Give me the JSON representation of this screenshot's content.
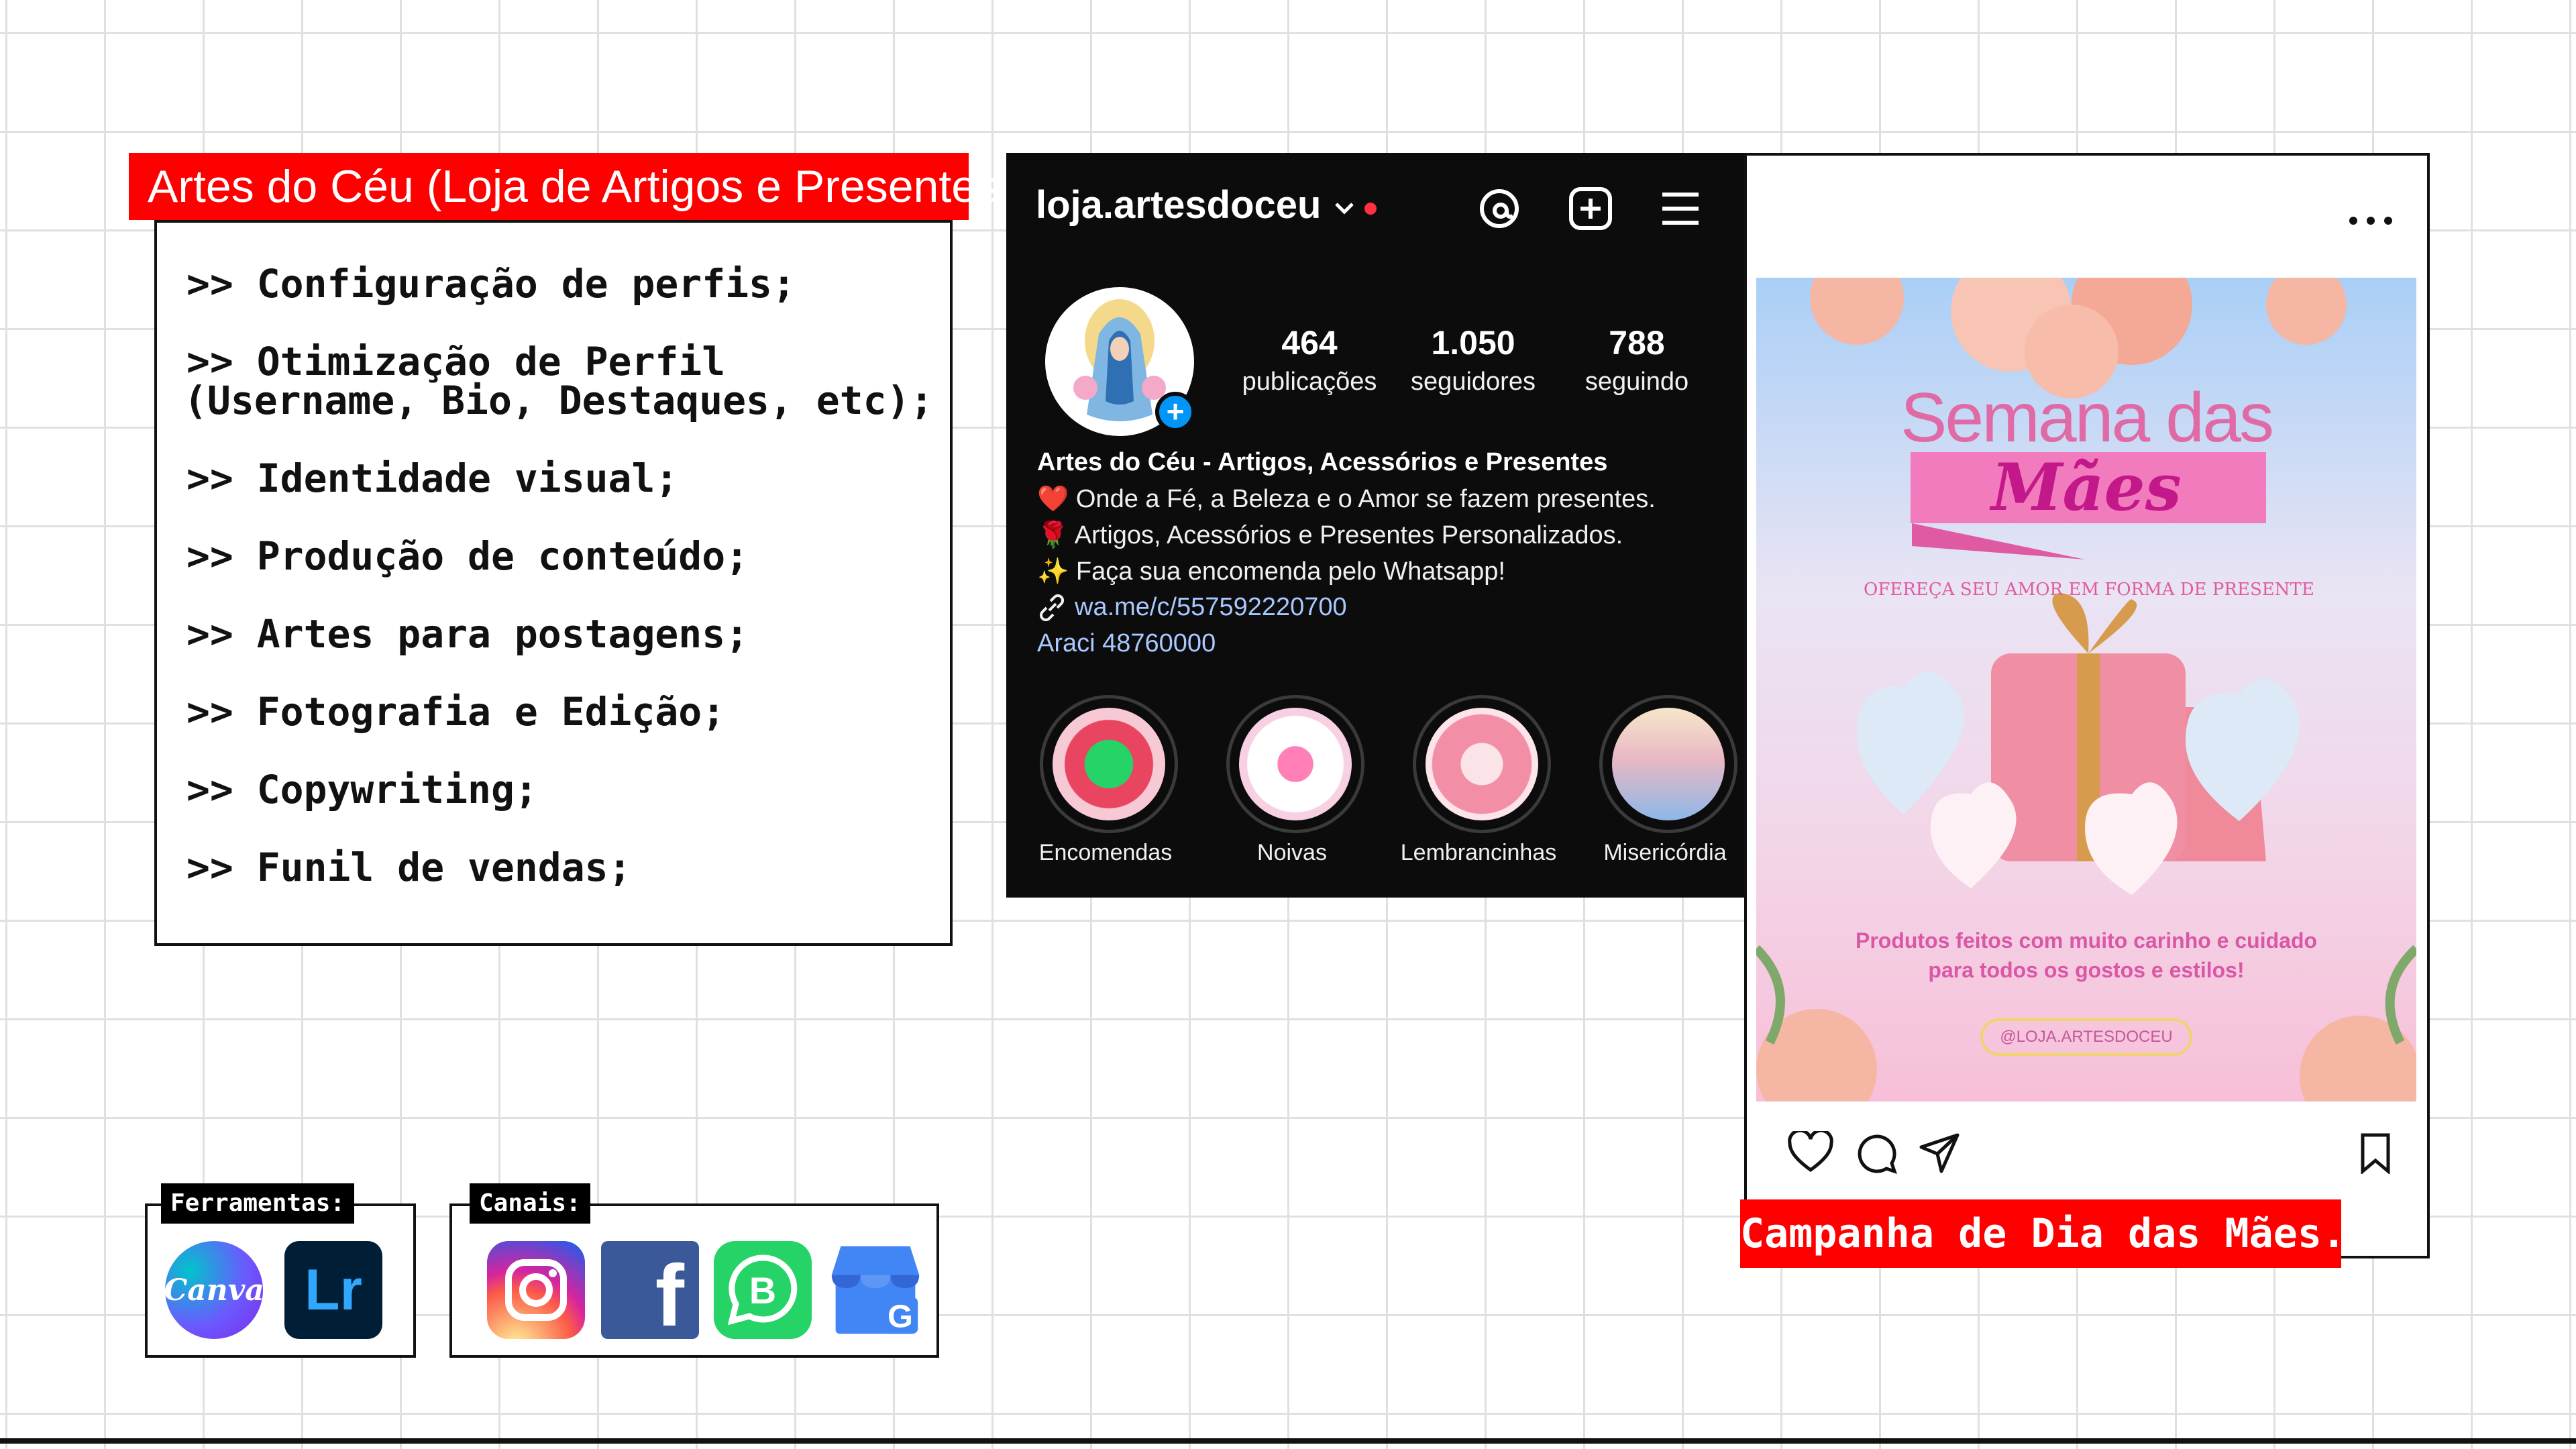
{
  "panel": {
    "title": "Artes do Céu (Loja de Artigos e Presentes)",
    "services": [
      ">> Configuração de perfis;",
      ">> Otimização de Perfil",
      "(Username, Bio, Destaques, etc);",
      ">> Identidade visual;",
      ">> Produção de conteúdo;",
      ">> Artes para postagens;",
      ">> Fotografia e Edição;",
      ">> Copywriting;",
      ">> Funil de vendas;"
    ]
  },
  "tools": {
    "label": "Ferramentas:",
    "items": [
      {
        "icon": "canva-logo-icon",
        "text": "Canva",
        "color": "#7d2ae8"
      },
      {
        "icon": "lightroom-logo-icon",
        "text": "Lr",
        "color": "#001e36"
      }
    ]
  },
  "channels": {
    "label": "Canais:",
    "items": [
      {
        "icon": "instagram-logo-icon"
      },
      {
        "icon": "facebook-logo-icon",
        "text": "f",
        "color": "#3b5998"
      },
      {
        "icon": "whatsapp-business-logo-icon",
        "text": "B",
        "color": "#25d366"
      },
      {
        "icon": "google-my-business-logo-icon",
        "text": "G",
        "color": "#4285f4"
      }
    ]
  },
  "instagram": {
    "username": "loja.artesdoceu",
    "stats": [
      {
        "value": "464",
        "label": "publicações"
      },
      {
        "value": "1.050",
        "label": "seguidores"
      },
      {
        "value": "788",
        "label": "seguindo"
      }
    ],
    "bio": {
      "name": "Artes do Céu - Artigos, Acessórios e Presentes",
      "line1": "❤️ Onde a Fé, a Beleza e o Amor se fazem presentes.",
      "line2": "🌹 Artigos, Acessórios e Presentes Personalizados.",
      "line3": "✨ Faça sua encomenda pelo Whatsapp!",
      "link": "wa.me/c/557592220700",
      "location": "Araci 48760000"
    },
    "highlights": [
      {
        "label": "Encomendas"
      },
      {
        "label": "Noivas"
      },
      {
        "label": "Lembrancinhas"
      },
      {
        "label": "Misericórdia"
      }
    ],
    "accent_red": "#ff3040",
    "link_color": "#a8c8ff"
  },
  "post": {
    "title_line1": "Semana das",
    "title_line2": "Mães",
    "arc_text": "OFEREÇA SEU AMOR EM FORMA DE PRESENTE",
    "tagline_line1": "Produtos feitos com muito carinho e cuidado",
    "tagline_line2": "para todos os gostos e estilos!",
    "handle": "@LOJA.ARTESDOCEU",
    "campaign_label": "Campanha de Dia das Mães."
  }
}
